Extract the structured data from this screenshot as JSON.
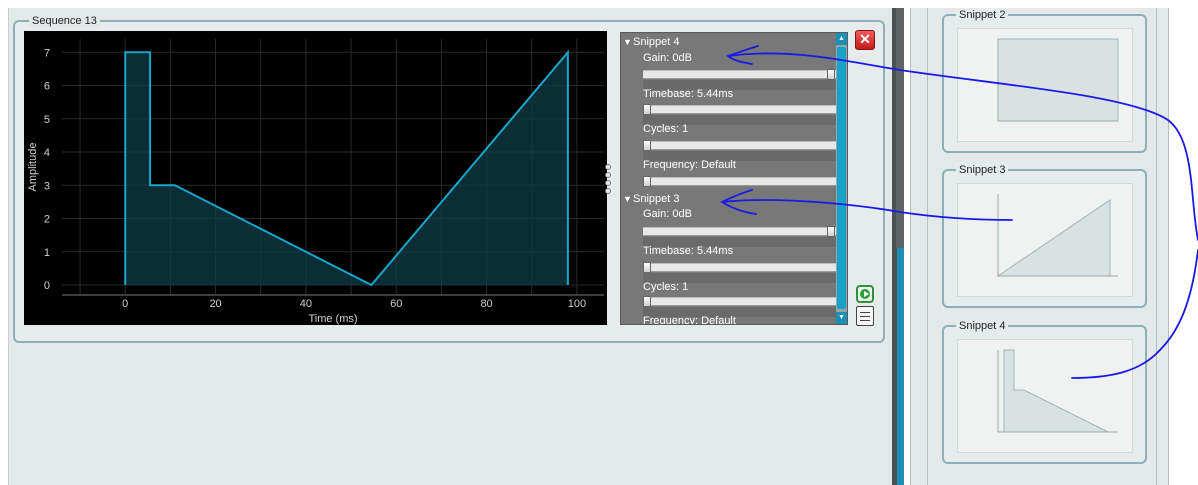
{
  "sequence": {
    "title": "Sequence 13"
  },
  "chart_data": {
    "type": "area",
    "xlabel": "Time (ms)",
    "ylabel": "Amplitude",
    "xlim": [
      -14,
      106
    ],
    "ylim": [
      -0.3,
      7.4
    ],
    "x_ticks": [
      "0",
      "20",
      "40",
      "60",
      "80",
      "100"
    ],
    "y_ticks": [
      "0",
      "1",
      "2",
      "3",
      "4",
      "5",
      "6",
      "7"
    ],
    "grid": true,
    "series": [
      {
        "x": [
          0,
          0,
          5.5,
          5.5,
          11,
          54.5,
          98,
          98
        ],
        "y": [
          0,
          7,
          7,
          3,
          3,
          0,
          7,
          0
        ]
      }
    ],
    "colors": {
      "line": "#1aa6c8",
      "fill": "#0f3c48",
      "fill_dark": "#16303a",
      "grid": "#2a2a2a",
      "text": "#cfcfcf"
    }
  },
  "snippets_panel": {
    "sections": [
      {
        "name": "Snippet 4",
        "gain": "Gain: 0dB",
        "timebase": "Timebase: 5.44ms",
        "cycles": "Cycles: 1",
        "frequency": "Frequency: Default",
        "gain_level": 1.0,
        "timebase_level": 0.0,
        "cycles_level": 0.0,
        "frequency_level": 0.0
      },
      {
        "name": "Snippet 3",
        "gain": "Gain: 0dB",
        "timebase": "Timebase: 5.44ms",
        "cycles": "Cycles: 1",
        "frequency": "Frequency: Default",
        "gain_level": 1.0,
        "timebase_level": 0.0,
        "cycles_level": 0.0
      }
    ]
  },
  "library": {
    "cards": [
      {
        "title": "Snippet 2"
      },
      {
        "title": "Snippet 3"
      },
      {
        "title": "Snippet 4"
      }
    ]
  },
  "icons": {
    "close": "close-icon",
    "play": "play-icon",
    "document": "document-icon",
    "drag": "drag-handle-icon"
  },
  "colors": {
    "accent": "#1d8fb5",
    "close": "#d42a2a",
    "play": "#2f9c3c",
    "annotation": "#1a1ae6"
  }
}
